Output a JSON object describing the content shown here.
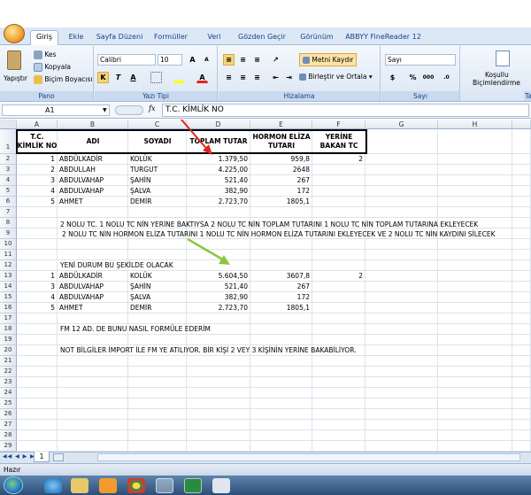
{
  "ribbon": {
    "tabs": [
      "Giriş",
      "Ekle",
      "Sayfa Düzeni",
      "Formüller",
      "Veri",
      "Gözden Geçir",
      "Görünüm",
      "ABBYY FineReader 12"
    ],
    "active_tab": "Giriş",
    "clipboard": {
      "paste": "Yapıştır",
      "cut": "Kes",
      "copy": "Kopyala",
      "format_painter": "Biçim Boyacısı",
      "group": "Pano"
    },
    "font": {
      "name": "Calibri",
      "size": "10",
      "group": "Yazı Tipi",
      "bold": "K",
      "italic": "T",
      "underline": "A"
    },
    "alignment": {
      "wrap": "Metni Kaydır",
      "merge": "Birleştir ve Ortala",
      "group": "Hizalama"
    },
    "number": {
      "format": "Sayı",
      "percent": "%",
      "comma": "000",
      "group": "Sayı"
    },
    "styles": {
      "conditional": "Koşullu",
      "conditional2": "Biçimlendirme",
      "group_cut": "Ta"
    }
  },
  "formula_bar": {
    "cell": "A1",
    "fx": "fx",
    "value": "T.C. KİMLİK NO"
  },
  "columns": [
    "A",
    "B",
    "C",
    "D",
    "E",
    "F",
    "G",
    "H"
  ],
  "rows": [
    "1",
    "2",
    "3",
    "4",
    "5",
    "6",
    "7",
    "8",
    "9",
    "10",
    "11",
    "12",
    "13",
    "14",
    "15",
    "16",
    "17",
    "18",
    "19",
    "20",
    "21",
    "22",
    "23",
    "24",
    "25",
    "26",
    "27",
    "28",
    "29"
  ],
  "table_header": {
    "a": "T.C. KİMLİK NO",
    "b": "ADI",
    "c": "SOYADI",
    "d": "TOPLAM TUTAR",
    "e": "HORMON ELİZA TUTARI",
    "f": "YERİNE BAKAN TC"
  },
  "data_rows": [
    {
      "a": "1",
      "b": "ABDÜLKADİR",
      "c": "KOLÜK",
      "d": "1.379,50",
      "e": "959,8",
      "f": "2"
    },
    {
      "a": "2",
      "b": "ABDULLAH",
      "c": "TURGUT",
      "d": "4.225,00",
      "e": "2648",
      "f": ""
    },
    {
      "a": "3",
      "b": "ABDULVAHAP",
      "c": "ŞAHİN",
      "d": "521,40",
      "e": "267",
      "f": ""
    },
    {
      "a": "4",
      "b": "ABDULVAHAP",
      "c": "ŞALVA",
      "d": "382,90",
      "e": "172",
      "f": ""
    },
    {
      "a": "5",
      "b": "AHMET",
      "c": "DEMİR",
      "d": "2.723,70",
      "e": "1805,1",
      "f": ""
    }
  ],
  "notes": {
    "r8": "2 NOLU TC. 1 NOLU TC NİN YERİNE BAKTIYSA 2 NOLU TC NİN TOPLAM TUTARINI 1 NOLU TC NİN TOPLAM TUTARINA EKLEYECEK",
    "r9": "2 NOLU TC NİN HORMON ELİZA TUTARINI 1 NOLU TC NİN HORMON ELİZA TUTARINI EKLEYECEK VE 2 NOLU TC NİN KAYDINI SİLECEK",
    "r12": "YENİ DURUM BU ŞEKİLDE OLACAK",
    "r18": "FM 12 AD. DE BUNU NASIL FORMÜLE EDERİM",
    "r20": "NOT BİLGİLER İMPORT İLE FM YE ATILIYOR. BİR KİŞİ 2 VEY 3 KİŞİNİN YERİNE BAKABİLİYOR."
  },
  "result_rows": [
    {
      "a": "1",
      "b": "ABDÜLKADİR",
      "c": "KOLÜK",
      "d": "5.604,50",
      "e": "3607,8",
      "f": "2"
    },
    {
      "a": "3",
      "b": "ABDULVAHAP",
      "c": "ŞAHİN",
      "d": "521,40",
      "e": "267",
      "f": ""
    },
    {
      "a": "4",
      "b": "ABDULVAHAP",
      "c": "ŞALVA",
      "d": "382,90",
      "e": "172",
      "f": ""
    },
    {
      "a": "5",
      "b": "AHMET",
      "c": "DEMİR",
      "d": "2.723,70",
      "e": "1805,1",
      "f": ""
    }
  ],
  "sheet": {
    "tab": "1"
  },
  "status": {
    "text": "Hazır"
  },
  "colors": {
    "arrow_red": "#e0261c",
    "arrow_green": "#8cc63f"
  }
}
